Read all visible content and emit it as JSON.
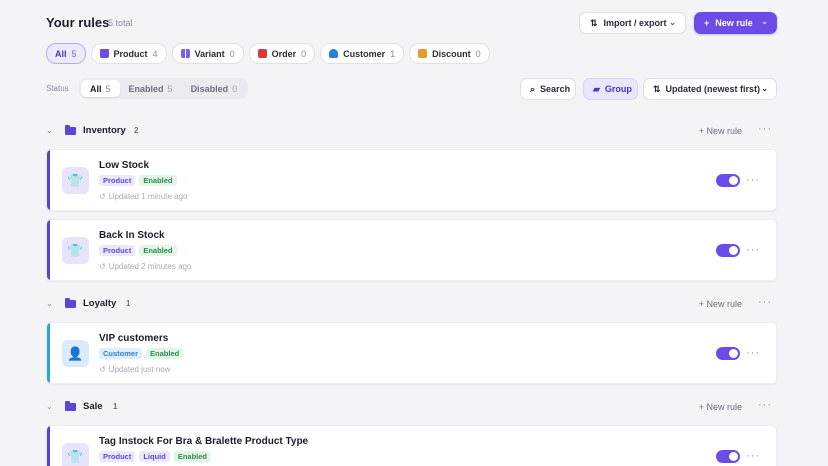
{
  "header": {
    "title": "Your rules",
    "count": "5 total",
    "import_label": "Import / export",
    "new_rule_label": "New rule"
  },
  "filters": [
    {
      "label": "All",
      "count": "5"
    },
    {
      "label": "Product",
      "count": "4",
      "icon": "shirt-icon"
    },
    {
      "label": "Variant",
      "count": "0",
      "icon": "grid-icon"
    },
    {
      "label": "Order",
      "count": "0",
      "icon": "order-icon"
    },
    {
      "label": "Customer",
      "count": "1",
      "icon": "person-icon"
    },
    {
      "label": "Discount",
      "count": "0",
      "icon": "discount-icon"
    }
  ],
  "status": {
    "label": "Status",
    "options": [
      {
        "label": "All",
        "count": "5"
      },
      {
        "label": "Enabled",
        "count": "5"
      },
      {
        "label": "Disabled",
        "count": "0"
      }
    ]
  },
  "toolbar": {
    "search_label": "Search",
    "group_label": "Group",
    "sort_label": "Updated (newest first)"
  },
  "groups": [
    {
      "name": "Inventory",
      "count": "2",
      "new_rule": "New rule",
      "rules": [
        {
          "name": "Low Stock",
          "tags": [
            "Product",
            "Enabled"
          ],
          "updated": "Updated 1 minute ago",
          "accent": "#5b3fe0",
          "enabled": true
        },
        {
          "name": "Back In Stock",
          "tags": [
            "Product",
            "Enabled"
          ],
          "updated": "Updated 2 minutes ago",
          "accent": "#5b3fe0",
          "enabled": true
        }
      ]
    },
    {
      "name": "Loyalty",
      "count": "1",
      "new_rule": "New rule",
      "rules": [
        {
          "name": "VIP customers",
          "tags": [
            "Customer",
            "Enabled"
          ],
          "updated": "Updated just now",
          "accent": "#28a7d8",
          "enabled": true
        }
      ]
    },
    {
      "name": "Sale",
      "count": "1",
      "new_rule": "New rule",
      "rules": [
        {
          "name": "Tag Instock For Bra & Bralette Product Type",
          "tags": [
            "Product",
            "Liquid",
            "Enabled"
          ],
          "updated": "",
          "accent": "#5b3fe0",
          "enabled": true
        }
      ]
    }
  ],
  "colors": {
    "accent": "#6b4ce6",
    "product_bar": "#5b3fe0",
    "customer_bar": "#28a7d8",
    "enabled": "#2e8a4a"
  }
}
